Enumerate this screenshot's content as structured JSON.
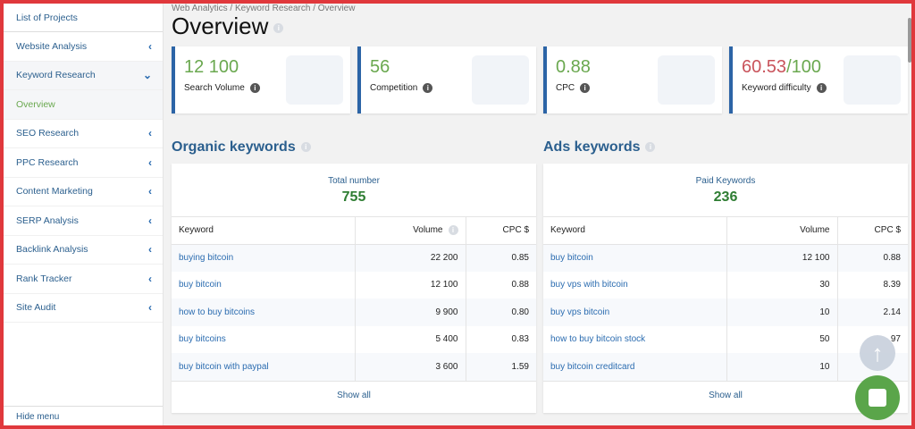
{
  "sidebar": {
    "items": [
      {
        "label": "List of Projects",
        "chevron": ""
      },
      {
        "label": "Website Analysis",
        "chevron": "‹"
      },
      {
        "label": "Keyword Research",
        "chevron": "⌄"
      },
      {
        "label": "Overview",
        "chevron": ""
      },
      {
        "label": "SEO Research",
        "chevron": "‹"
      },
      {
        "label": "PPC Research",
        "chevron": "‹"
      },
      {
        "label": "Content Marketing",
        "chevron": "‹"
      },
      {
        "label": "SERP Analysis",
        "chevron": "‹"
      },
      {
        "label": "Backlink Analysis",
        "chevron": "‹"
      },
      {
        "label": "Rank Tracker",
        "chevron": "‹"
      },
      {
        "label": "Site Audit",
        "chevron": "‹"
      }
    ],
    "hide": "Hide menu"
  },
  "breadcrumb": "Web Analytics / Keyword Research / Overview",
  "title": "Overview",
  "cards": [
    {
      "value": "12 100",
      "label": "Search Volume"
    },
    {
      "value": "56",
      "label": "Competition"
    },
    {
      "value": "0.88",
      "label": "CPC"
    },
    {
      "value": "60.53",
      "value_suffix": "/100",
      "label": "Keyword difficulty"
    }
  ],
  "organic": {
    "heading": "Organic keywords",
    "total_label": "Total number",
    "total": "755",
    "columns": [
      "Keyword",
      "Volume",
      "CPC $"
    ],
    "rows": [
      [
        "buying bitcoin",
        "22 200",
        "0.85"
      ],
      [
        "buy bitcoin",
        "12 100",
        "0.88"
      ],
      [
        "how to buy bitcoins",
        "9 900",
        "0.80"
      ],
      [
        "buy bitcoins",
        "5 400",
        "0.83"
      ],
      [
        "buy bitcoin with paypal",
        "3 600",
        "1.59"
      ]
    ],
    "show_all": "Show all"
  },
  "ads": {
    "heading": "Ads keywords",
    "total_label": "Paid Keywords",
    "total": "236",
    "columns": [
      "Keyword",
      "Volume",
      "CPC $"
    ],
    "rows": [
      [
        "buy bitcoin",
        "12 100",
        "0.88"
      ],
      [
        "buy vps with bitcoin",
        "30",
        "8.39"
      ],
      [
        "buy vps bitcoin",
        "10",
        "2.14"
      ],
      [
        "how to buy bitcoin stock",
        "50",
        "97"
      ],
      [
        "buy bitcoin creditcard",
        "10",
        ""
      ]
    ],
    "show_all": "Show all"
  }
}
